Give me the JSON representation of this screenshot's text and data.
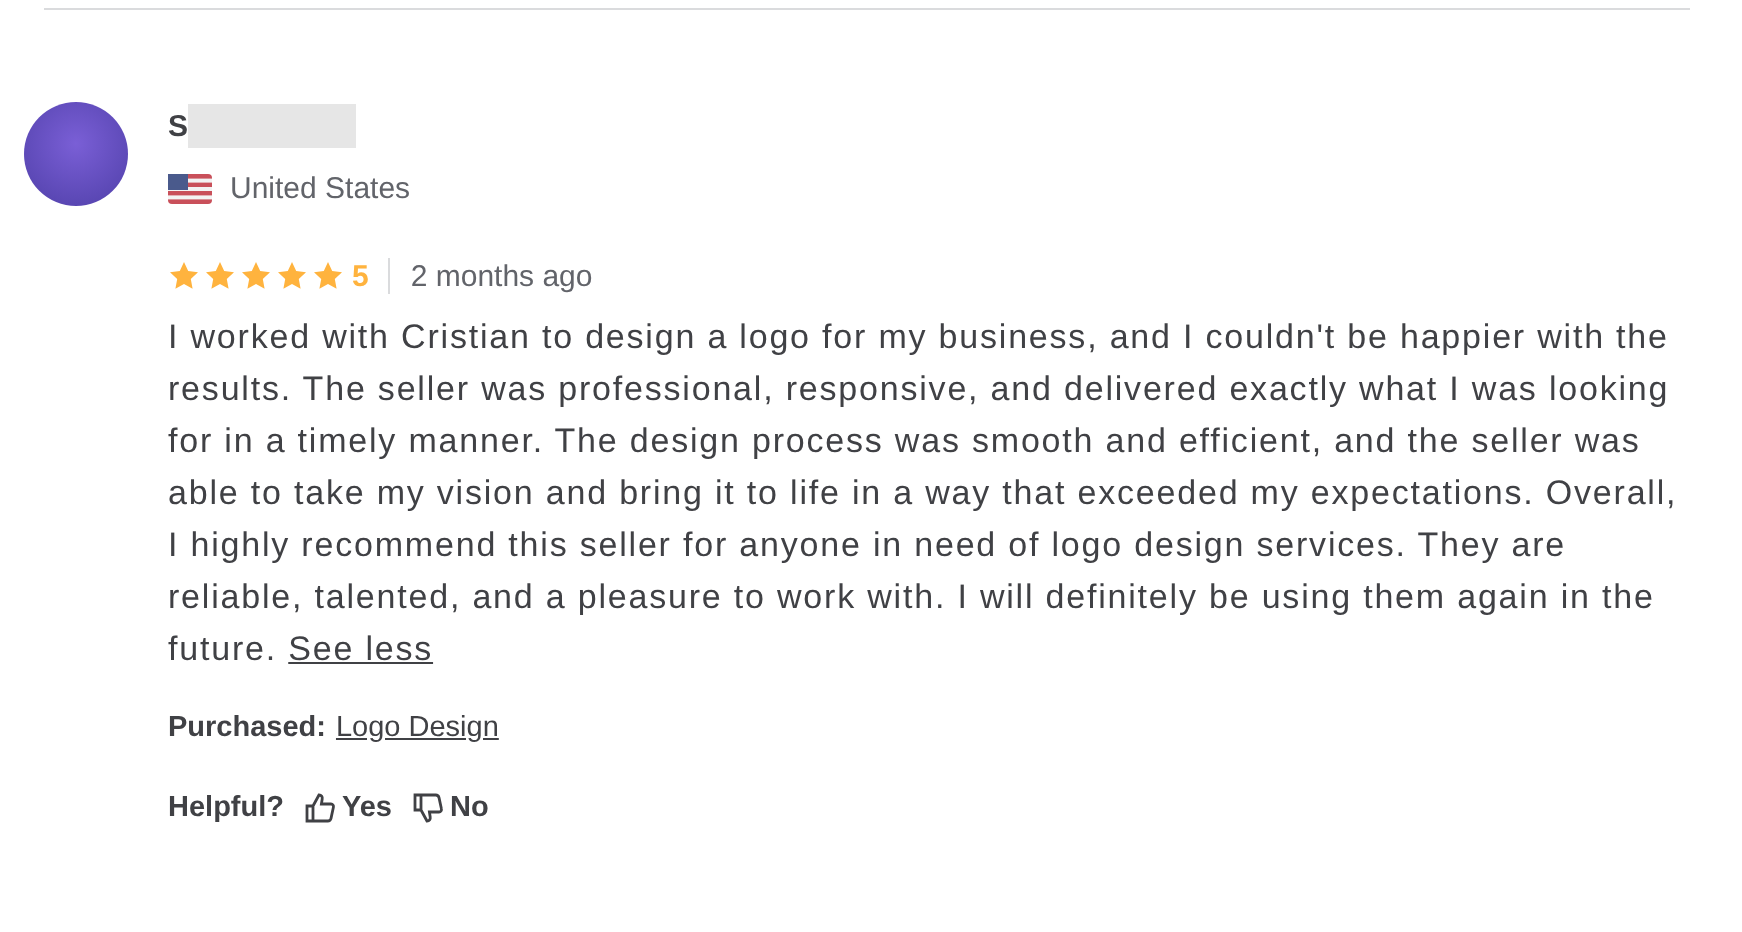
{
  "reviewer": {
    "name": "S",
    "country": "United States"
  },
  "rating": {
    "stars": 5,
    "score": "5",
    "time": "2 months ago"
  },
  "review": {
    "text": "I worked with Cristian to design a logo for my business, and I couldn't be happier with the results. The seller was professional, responsive, and delivered exactly what I was looking for in a timely manner. The design process was smooth and efficient, and the seller was able to take my vision and bring it to life in a way that exceeded my expectations. Overall, I highly recommend this seller for anyone in need of logo design services. They are reliable, talented, and a pleasure to work with. I will definitely be using them again in the future.",
    "toggle": "See less"
  },
  "purchased": {
    "label": "Purchased:",
    "item": "Logo Design"
  },
  "helpful": {
    "label": "Helpful?",
    "yes": "Yes",
    "no": "No"
  }
}
